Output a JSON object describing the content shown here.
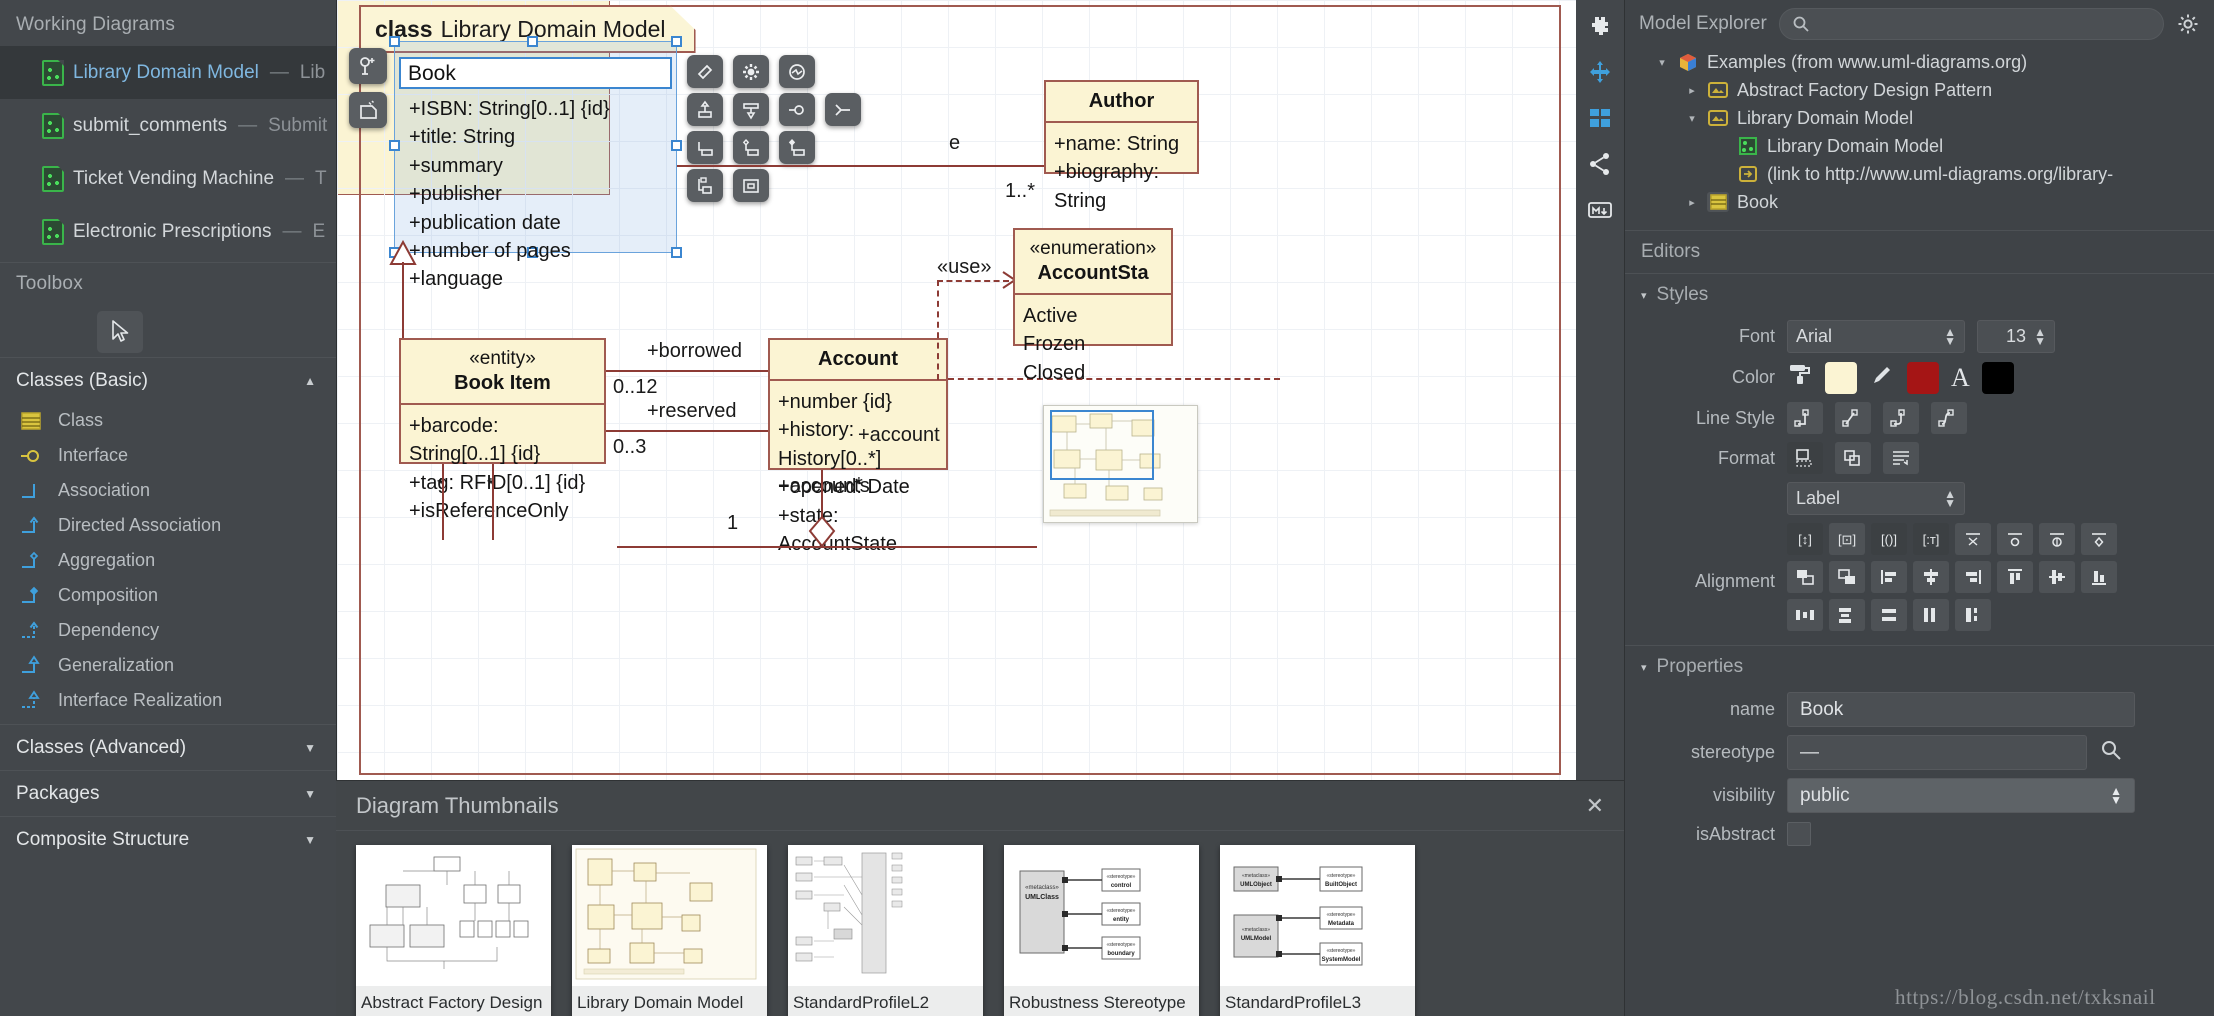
{
  "sidebar": {
    "working_diagrams_title": "Working Diagrams",
    "diagrams": [
      {
        "name": "Library Domain Model",
        "dash": "—",
        "desc": "Lib",
        "icon": "class-diagram-icon",
        "selected": true
      },
      {
        "name": "submit_comments",
        "dash": "—",
        "desc": "Submit",
        "icon": "activity-diagram-icon",
        "selected": false
      },
      {
        "name": "Ticket Vending Machine",
        "dash": "—",
        "desc": "T",
        "icon": "usecase-diagram-icon",
        "selected": false
      },
      {
        "name": "Electronic Prescriptions",
        "dash": "—",
        "desc": "E",
        "icon": "usecase-diagram-icon",
        "selected": false
      }
    ],
    "toolbox_title": "Toolbox",
    "cursor_tool": "select-pointer-tool",
    "groups": [
      {
        "label": "Classes (Basic)",
        "caret": "▲",
        "expanded": true,
        "items": [
          {
            "label": "Class",
            "icon": "class-icon"
          },
          {
            "label": "Interface",
            "icon": "interface-icon"
          },
          {
            "label": "Association",
            "icon": "association-icon"
          },
          {
            "label": "Directed Association",
            "icon": "directed-association-icon"
          },
          {
            "label": "Aggregation",
            "icon": "aggregation-icon"
          },
          {
            "label": "Composition",
            "icon": "composition-icon"
          },
          {
            "label": "Dependency",
            "icon": "dependency-icon"
          },
          {
            "label": "Generalization",
            "icon": "generalization-icon"
          },
          {
            "label": "Interface Realization",
            "icon": "interface-realization-icon"
          }
        ]
      },
      {
        "label": "Classes (Advanced)",
        "caret": "▼",
        "expanded": false,
        "items": []
      },
      {
        "label": "Packages",
        "caret": "▼",
        "expanded": false,
        "items": []
      },
      {
        "label": "Composite Structure",
        "caret": "▼",
        "expanded": false,
        "items": []
      }
    ]
  },
  "canvas": {
    "frame_keyword": "class",
    "frame_title": "Library Domain Model",
    "book": {
      "name_value": "Book",
      "attributes": [
        "+ISBN: String[0..1] {id}",
        "+title: String",
        "+summary",
        "+publisher",
        "+publication date",
        "+number of pages",
        "+language"
      ]
    },
    "author": {
      "title": "Author",
      "attributes": [
        "+name: String",
        "+biography: String"
      ]
    },
    "book_item": {
      "stereotype": "«entity»",
      "title": "Book Item",
      "attributes": [
        "+barcode: String[0..1] {id}",
        "+tag: RFID[0..1] {id}",
        "+isReferenceOnly"
      ]
    },
    "account": {
      "title": "Account",
      "attributes": [
        "+number {id}",
        "+history: History[0..*]",
        "+opened: Date",
        "+state: AccountState"
      ]
    },
    "account_state": {
      "stereotype": "«enumeration»",
      "title": "AccountSta",
      "literals": [
        "Active",
        "Frozen",
        "Closed"
      ]
    },
    "edge_labels": {
      "author_mult": "1..*",
      "borrowed": "+borrowed",
      "borrowed_mult": "0..12",
      "reserved": "+reserved",
      "reserved_mult": "0..3",
      "account_role": "+account",
      "accounts_role": "+accounts",
      "star_left": "*",
      "star_mid": "*",
      "star_account": "*",
      "one": "1",
      "use": "«use»",
      "partial_e": "e"
    },
    "context_toolbar_icons": [
      "note-icon",
      "gear-icon",
      "refresh-icon",
      "generalization-icon",
      "realization-icon",
      "interface-icon",
      "branch-icon",
      "association-icon",
      "aggregation-icon",
      "composition-icon",
      "dependency-icon",
      "nested-class-icon"
    ],
    "quick_tools": [
      "add-attribute-icon",
      "add-note-icon"
    ]
  },
  "dock": {
    "buttons": [
      "plugin-icon",
      "move-icon",
      "layout-icon",
      "share-icon",
      "markdown-icon"
    ]
  },
  "thumbnails": {
    "title": "Diagram Thumbnails",
    "close": "✕",
    "items": [
      {
        "caption": "Abstract Factory Design"
      },
      {
        "caption": "Library Domain Model"
      },
      {
        "caption": "StandardProfileL2"
      },
      {
        "caption": "Robustness Stereotype"
      },
      {
        "caption": "StandardProfileL3"
      }
    ]
  },
  "model_explorer": {
    "title": "Model Explorer",
    "search_placeholder": "",
    "search_icon": "search-icon",
    "settings_icon": "gear-icon",
    "tree": [
      {
        "label": "Examples (from www.uml-diagrams.org)",
        "indent": 0,
        "twisty": "▾",
        "icon": "package-cube-icon",
        "selected": false
      },
      {
        "label": "Abstract Factory Design Pattern",
        "indent": 1,
        "twisty": "▸",
        "icon": "model-folder-icon",
        "selected": false
      },
      {
        "label": "Library Domain Model",
        "indent": 1,
        "twisty": "▾",
        "icon": "model-folder-icon",
        "selected": false
      },
      {
        "label": "Library Domain Model",
        "indent": 2,
        "twisty": "",
        "icon": "class-diagram-icon",
        "selected": false
      },
      {
        "label": "(link to http://www.uml-diagrams.org/library-",
        "indent": 2,
        "twisty": "",
        "icon": "link-icon",
        "selected": false
      },
      {
        "label": "Book",
        "indent": 1,
        "twisty": "▸",
        "icon": "class-icon",
        "selected": true
      }
    ]
  },
  "editors": {
    "title": "Editors"
  },
  "styles": {
    "title": "Styles",
    "triangle": "▾",
    "font_label": "Font",
    "font_value": "Arial",
    "font_size": "13",
    "color_label": "Color",
    "fill_icon": "paint-roller-icon",
    "fill_color": "#fbf4d3",
    "line_icon": "pencil-icon",
    "line_color": "#a51515",
    "text_icon": "font-letter-icon",
    "text_color": "#000000",
    "line_style_label": "Line Style",
    "line_styles": [
      "rectilinear-icon",
      "oblique-icon",
      "rounded-icon",
      "curved-icon"
    ],
    "format_label": "Format",
    "format_buttons": [
      "auto-fit-icon",
      "duplicate-icon",
      "wrap-text-icon"
    ],
    "label_select_value": "Label",
    "alignment_label": "Alignment",
    "row1_buttons": [
      "show-attributes-icon",
      "show-operations-icon",
      "show-parameters-icon",
      "show-types-icon",
      "hide-compartment-icon",
      "hide-operations-icon",
      "hide-signature-icon",
      "hide-all-icon"
    ],
    "row2_buttons": [
      "bring-to-front-icon",
      "send-to-back-icon",
      "align-left-icon",
      "align-center-icon",
      "align-right-icon",
      "align-top-icon",
      "align-middle-icon",
      "align-bottom-icon"
    ],
    "row3_buttons": [
      "distribute-horizontal-icon",
      "distribute-vertical-icon",
      "same-height-icon",
      "same-width-icon",
      "same-size-icon"
    ]
  },
  "properties": {
    "title": "Properties",
    "triangle": "▾",
    "name_label": "name",
    "name_value": "Book",
    "stereotype_label": "stereotype",
    "stereotype_value": "—",
    "stereotype_search_icon": "search-icon",
    "visibility_label": "visibility",
    "visibility_value": "public",
    "isabstract_label": "isAbstract",
    "isabstract_checked": false
  },
  "watermark": "https://blog.csdn.net/txksnail"
}
